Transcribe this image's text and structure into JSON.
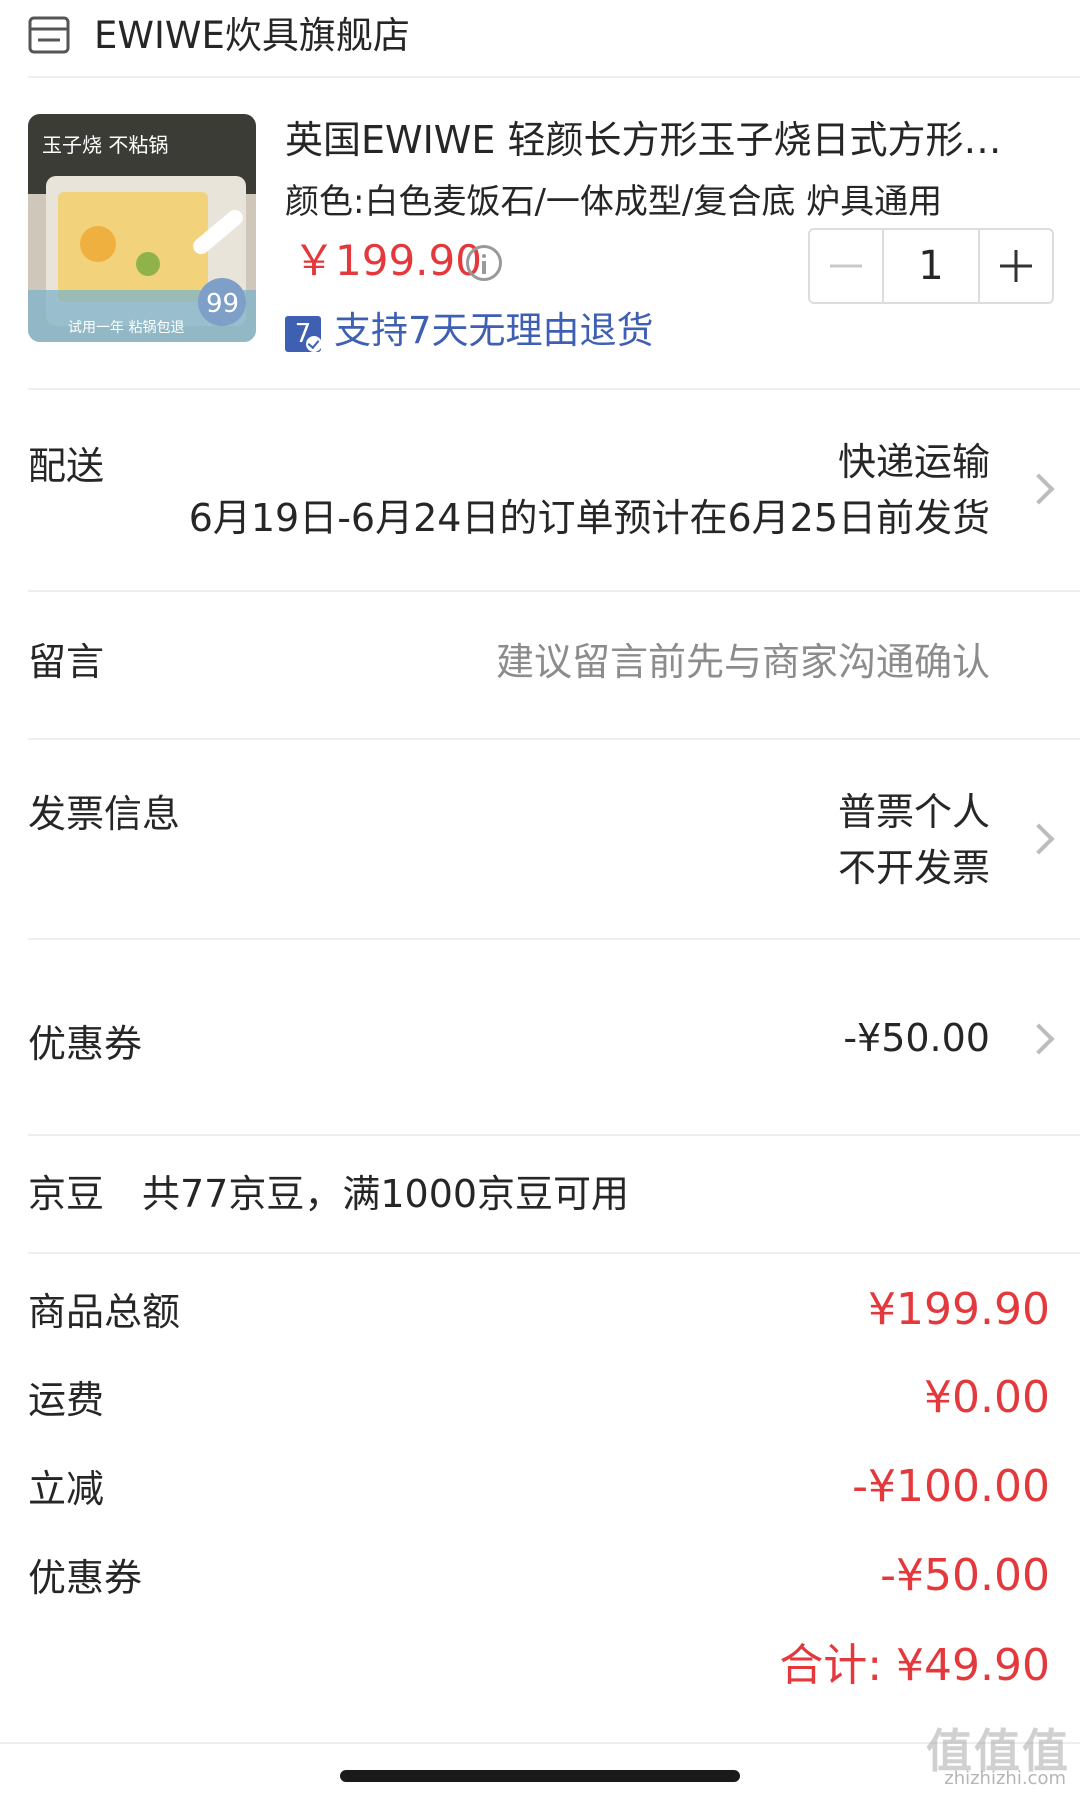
{
  "store": {
    "name": "EWIWE炊具旗舰店"
  },
  "product": {
    "title": "英国EWIWE 轻颜长方形玉子烧日式方形…",
    "spec": "颜色:白色麦饭石/一体成型/复合底 炉具通用",
    "price": "￥199.90",
    "quantity": "1",
    "return_badge": "7",
    "return_policy": "支持7天无理由退货",
    "thumb_texts": {
      "title_top": "玉子烧 不粘锅",
      "price_tag": "99",
      "bottom": "试用一年 粘锅包退"
    }
  },
  "delivery": {
    "label": "配送",
    "method": "快递运输",
    "note": "6月19日-6月24日的订单预计在6月25日前发货"
  },
  "message": {
    "label": "留言",
    "placeholder": "建议留言前先与商家沟通确认"
  },
  "invoice": {
    "label": "发票信息",
    "type": "普票个人",
    "status": "不开发票"
  },
  "coupon": {
    "label": "优惠券",
    "value": "-¥50.00"
  },
  "jingdou": {
    "label": "京豆",
    "note": "共77京豆，满1000京豆可用"
  },
  "summary": {
    "goods_total_label": "商品总额",
    "goods_total": "¥199.90",
    "shipping_label": "运费",
    "shipping": "¥0.00",
    "discount_label": "立减",
    "discount": "-¥100.00",
    "coupon_label": "优惠券",
    "coupon": "-¥50.00",
    "total": "合计: ¥49.90"
  },
  "watermark": {
    "main": "值值值",
    "sub": "zhizhizhi.com"
  },
  "colors": {
    "price_red": "#e4393c",
    "link_blue": "#3f5fb3",
    "divider": "#eeeeee"
  }
}
